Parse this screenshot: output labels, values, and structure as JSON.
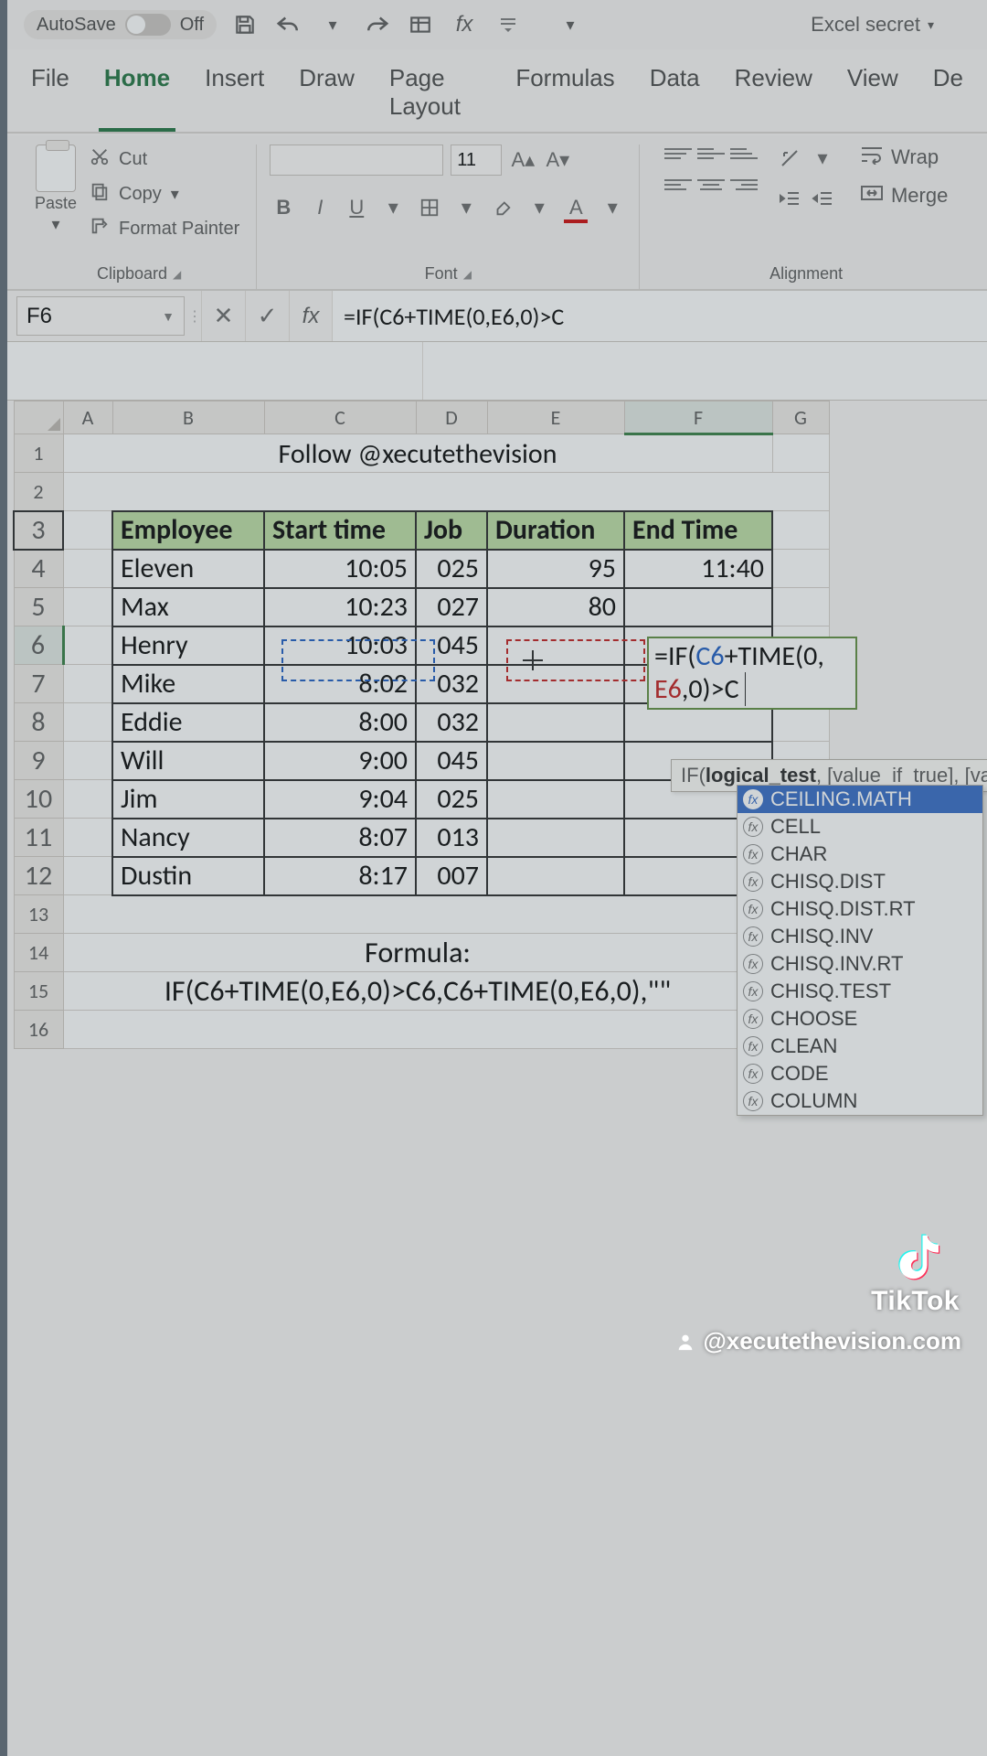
{
  "titlebar": {
    "autosave_label": "AutoSave",
    "autosave_state": "Off",
    "app_name": "Excel secret"
  },
  "tabs": [
    "File",
    "Home",
    "Insert",
    "Draw",
    "Page Layout",
    "Formulas",
    "Data",
    "Review",
    "View",
    "De"
  ],
  "active_tab_index": 1,
  "ribbon": {
    "clipboard": {
      "label": "Clipboard",
      "paste": "Paste",
      "cut": "Cut",
      "copy": "Copy",
      "painter": "Format Painter"
    },
    "font": {
      "label": "Font",
      "size": "11"
    },
    "alignment": {
      "label": "Alignment",
      "wrap": "Wrap",
      "merge": "Merge"
    }
  },
  "namebox": "F6",
  "formula_bar": "=IF(C6+TIME(0,E6,0)>C",
  "columns": [
    "A",
    "B",
    "C",
    "D",
    "E",
    "F",
    "G"
  ],
  "row_numbers": [
    1,
    2,
    3,
    4,
    5,
    6,
    7,
    8,
    9,
    10,
    11,
    12,
    13,
    14,
    15,
    16
  ],
  "title_cell": "Follow @xecutethevision",
  "headers": {
    "emp": "Employee",
    "start": "Start time",
    "job": "Job",
    "dur": "Duration",
    "end": "End Time"
  },
  "rows": [
    {
      "emp": "Eleven",
      "start": "10:05",
      "job": "025",
      "dur": "95",
      "end": "11:40"
    },
    {
      "emp": "Max",
      "start": "10:23",
      "job": "027",
      "dur": "80",
      "end": ""
    },
    {
      "emp": "Henry",
      "start": "10:03",
      "job": "045",
      "dur": "",
      "end": ""
    },
    {
      "emp": "Mike",
      "start": "8:02",
      "job": "032",
      "dur": "",
      "end": ""
    },
    {
      "emp": "Eddie",
      "start": "8:00",
      "job": "032",
      "dur": "",
      "end": ""
    },
    {
      "emp": "Will",
      "start": "9:00",
      "job": "045",
      "dur": "",
      "end": ""
    },
    {
      "emp": "Jim",
      "start": "9:04",
      "job": "025",
      "dur": "",
      "end": ""
    },
    {
      "emp": "Nancy",
      "start": "8:07",
      "job": "013",
      "dur": "",
      "end": ""
    },
    {
      "emp": "Dustin",
      "start": "8:17",
      "job": "007",
      "dur": "",
      "end": ""
    }
  ],
  "formula_label": "Formula:",
  "formula_text": "IF(C6+TIME(0,E6,0)>C6,C6+TIME(0,E6,0),\"\"",
  "editing_cell_lines": {
    "prefix": "=IF(",
    "c6": "C6",
    "mid1": "+TIME(0,",
    "break": "",
    "e6": "E6",
    "mid2": ",0)>C"
  },
  "tooltip": {
    "fn": "IF",
    "sig": "logical_test",
    "rest": ", [value_if_true], [valu"
  },
  "autocomplete": [
    "CEILING.MATH",
    "CELL",
    "CHAR",
    "CHISQ.DIST",
    "CHISQ.DIST.RT",
    "CHISQ.INV",
    "CHISQ.INV.RT",
    "CHISQ.TEST",
    "CHOOSE",
    "CLEAN",
    "CODE",
    "COLUMN"
  ],
  "autocomplete_selected_index": 0,
  "watermark": {
    "brand": "TikTok",
    "handle": "@xecutethevision.com"
  }
}
